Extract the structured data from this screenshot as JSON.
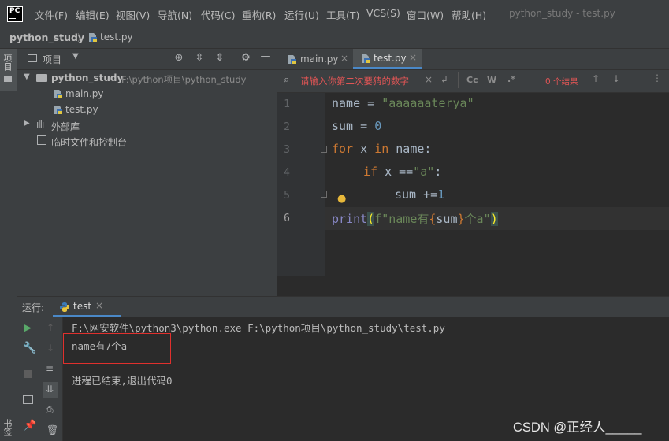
{
  "menubar": {
    "logo": "PC",
    "items": [
      "文件(F)",
      "编辑(E)",
      "视图(V)",
      "导航(N)",
      "代码(C)",
      "重构(R)",
      "运行(U)",
      "工具(T)",
      "VCS(S)",
      "窗口(W)",
      "帮助(H)"
    ],
    "window_title": "python_study - test.py"
  },
  "navbar": {
    "project": "python_study",
    "file": "test.py"
  },
  "leftstrip": {
    "project_tab": "项目",
    "bookmarks_tab": "书签"
  },
  "project_panel": {
    "title": "项目",
    "root_name": "python_study",
    "root_path": "F:\\python项目\\python_study",
    "files": [
      "main.py",
      "test.py"
    ],
    "external_libs": "外部库",
    "scratches": "临时文件和控制台"
  },
  "editor": {
    "tabs": [
      "main.py",
      "test.py"
    ],
    "search_placeholder": "请输入你第二次要猜的数字",
    "match_case": "Cc",
    "whole_word": "W",
    "regex": ".*",
    "result_count": "0 个结果",
    "line_numbers": [
      "1",
      "2",
      "3",
      "4",
      "5",
      "6"
    ]
  },
  "code": {
    "l1_name": "name",
    "l1_eq": " = ",
    "l1_str": "\"aaaaaaterya\"",
    "l2_name": "sum",
    "l2_eq": " = ",
    "l2_num": "0",
    "l3_for": "for",
    "l3_x": " x ",
    "l3_in": "in",
    "l3_rest": " name:",
    "l4_if": "if",
    "l4_x": " x ==",
    "l4_str": "\"a\"",
    "l4_colon": ":",
    "l5_sum": "sum +=",
    "l5_num": "1",
    "l6_print": "print",
    "l6_open": "(",
    "l6_f": "f\"name有",
    "l6_lb": "{",
    "l6_sum": "sum",
    "l6_rb": "}",
    "l6_tail": "个a\"",
    "l6_close": ")"
  },
  "run_panel": {
    "label": "运行:",
    "tab": "test",
    "command": "F:\\网安软件\\python3\\python.exe F:\\python项目\\python_study\\test.py",
    "output": "name有7个a",
    "exit": "进程已结束,退出代码0"
  },
  "watermark": "CSDN @正经人_____",
  "colors": {
    "keyword": "#cc7832",
    "string": "#6a8759",
    "number": "#6897bb",
    "builtin": "#8888c6",
    "highlight_box": "#e0302d",
    "run_green": "#59a869"
  }
}
